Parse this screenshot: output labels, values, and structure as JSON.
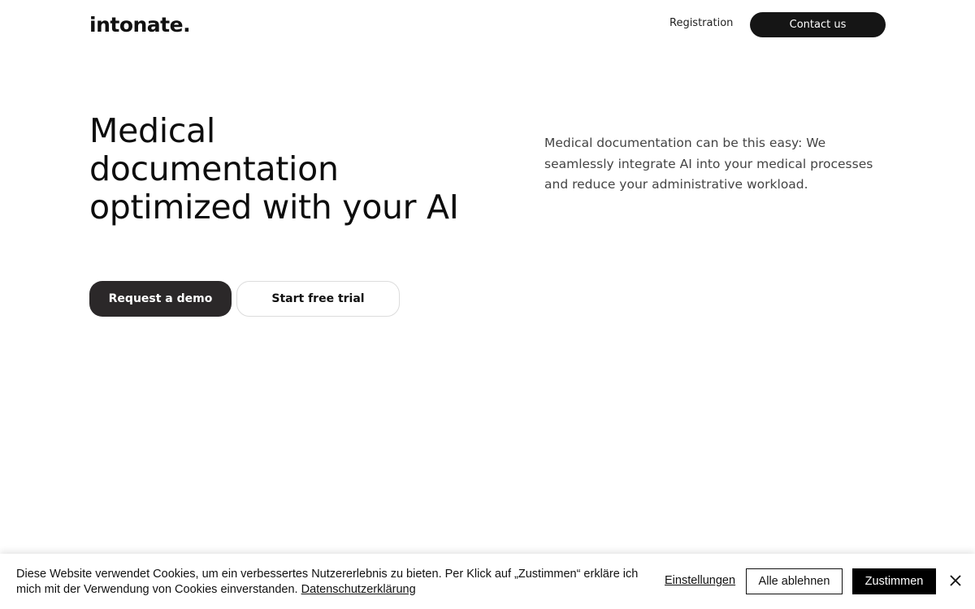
{
  "header": {
    "logo": "intonate.",
    "nav_registration": "Registration",
    "contact_label": "Contact us"
  },
  "hero": {
    "title_line1": "Medical",
    "title_line2": "documentation",
    "title_line3": "optimized with your AI",
    "description": "Medical documentation can be this easy: We seamlessly integrate AI into your medical processes and reduce your administrative workload.",
    "demo_label": "Request a demo",
    "trial_label": "Start free trial"
  },
  "cookie": {
    "text": "Diese Website verwendet Cookies, um ein verbessertes Nutzererlebnis zu bieten. Per Klick auf „Zustimmen“ erkläre ich mich mit der Verwendung von Cookies einverstanden. ",
    "privacy_link": "Datenschutzerklärung",
    "settings_label": "Einstellungen",
    "reject_label": "Alle ablehnen",
    "accept_label": "Zustimmen",
    "close_icon": "close-icon"
  }
}
